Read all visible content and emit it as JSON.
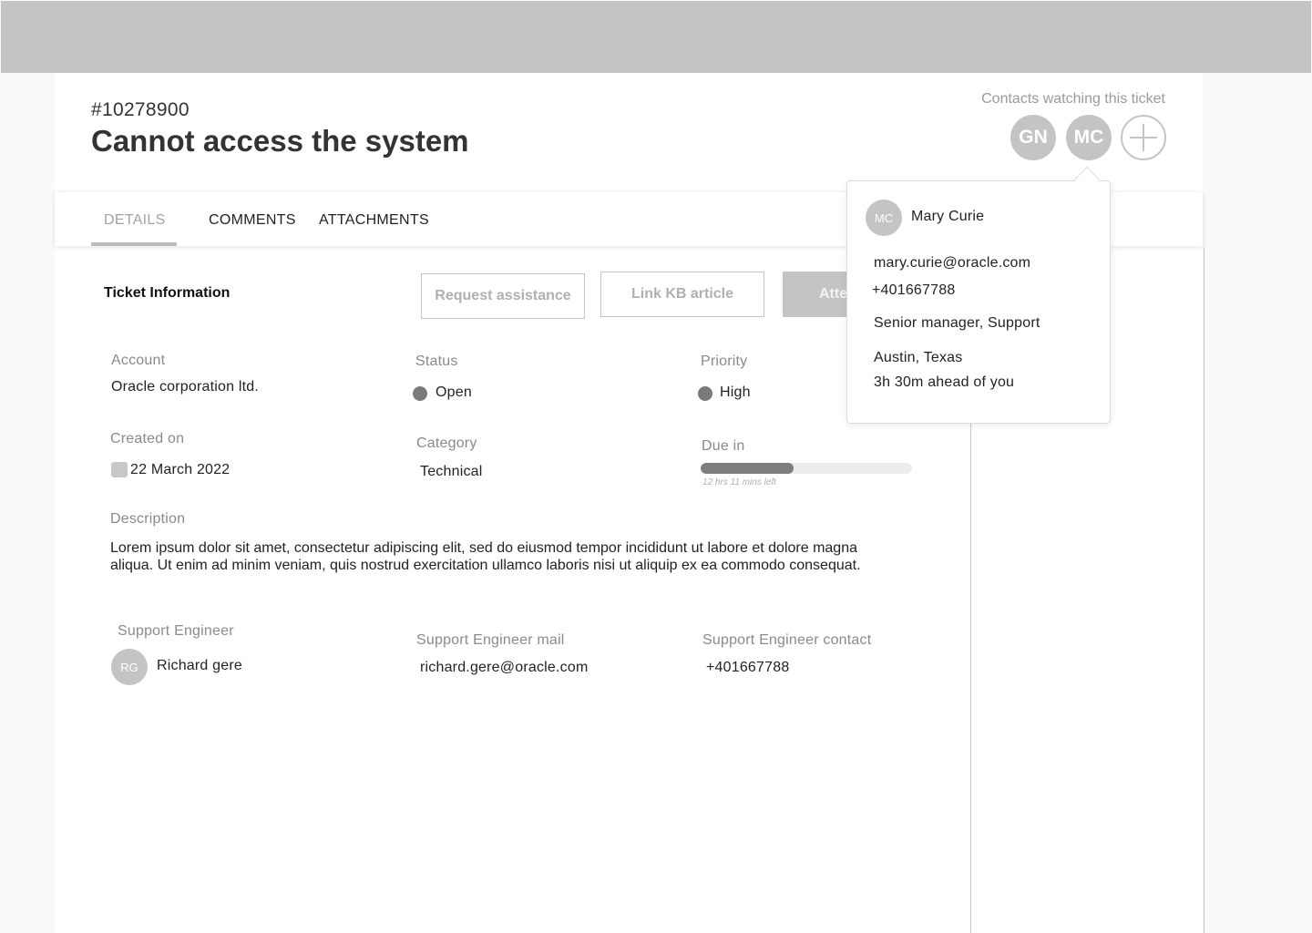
{
  "ticket": {
    "id": "#10278900",
    "title": "Cannot access the system"
  },
  "watchers": {
    "label": "Contacts watching this ticket",
    "avatars": [
      {
        "initials": "GN"
      },
      {
        "initials": "MC"
      }
    ]
  },
  "tabs": [
    {
      "label": "DETAILS",
      "active": true
    },
    {
      "label": "COMMENTS",
      "active": false
    },
    {
      "label": "ATTACHMENTS",
      "active": false
    }
  ],
  "section": {
    "title": "Ticket Information"
  },
  "actions": {
    "request_assistance": "Request assistance",
    "link_kb": "Link KB article",
    "attend": "Attend"
  },
  "fields": {
    "account_label": "Account",
    "account_value": "Oracle corporation ltd.",
    "status_label": "Status",
    "status_value": "Open",
    "priority_label": "Priority",
    "priority_value": "High",
    "created_label": "Created on",
    "created_value": "22 March 2022",
    "category_label": "Category",
    "category_value": "Technical",
    "due_label": "Due in",
    "due_caption": "12 hrs 11 mins left",
    "due_progress_fraction": 0.44,
    "description_label": "Description",
    "description_value": "Lorem ipsum dolor sit amet, consectetur adipiscing elit, sed do eiusmod tempor incididunt ut labore et dolore magna aliqua. Ut enim ad minim veniam, quis nostrud exercitation ullamco laboris nisi ut aliquip ex ea commodo consequat.",
    "engineer_label": "Support Engineer",
    "engineer_initials": "RG",
    "engineer_name": "Richard gere",
    "engineer_mail_label": "Support Engineer mail",
    "engineer_mail_value": "richard.gere@oracle.com",
    "engineer_contact_label": "Support Engineer contact",
    "engineer_contact_value": "+401667788"
  },
  "contact_card": {
    "initials": "MC",
    "name": "Mary Curie",
    "email": "mary.curie@oracle.com",
    "phone": "+401667788",
    "role": "Senior manager, Support",
    "location": "Austin, Texas",
    "time_offset": "3h 30m ahead of you"
  },
  "colors": {
    "placeholder_gray": "#c4c4c4",
    "status_dot": "#7a7a7a",
    "progress_fill": "#7d7d7d"
  }
}
